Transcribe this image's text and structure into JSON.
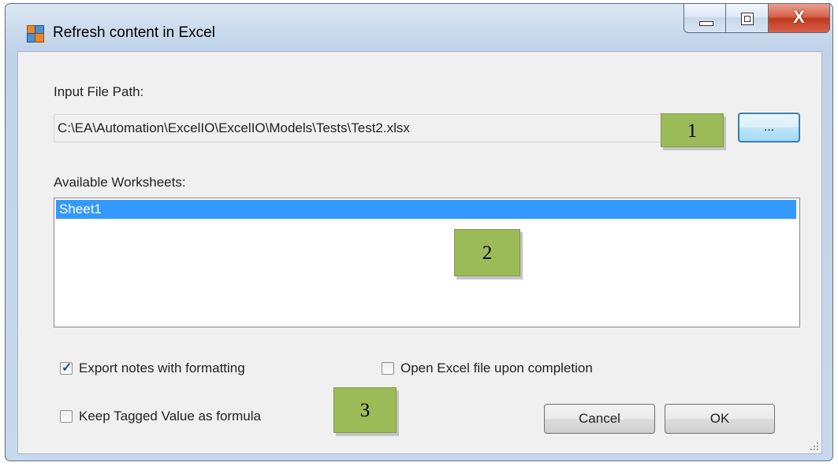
{
  "window": {
    "title": "Refresh content in Excel",
    "close_glyph": "X",
    "controls": [
      "minimize-icon",
      "maximize-icon",
      "close-icon"
    ]
  },
  "input_file": {
    "label": "Input File Path:",
    "value": "C:\\EA\\Automation\\ExcelIO\\ExcelIO\\Models\\Tests\\Test2.xlsx",
    "browse_label": "..."
  },
  "worksheets": {
    "label": "Available Worksheets:",
    "items": [
      {
        "label": "Sheet1",
        "selected": true
      }
    ]
  },
  "options": {
    "export_notes": {
      "label": "Export notes with formatting",
      "checked": true
    },
    "open_excel": {
      "label": "Open Excel file upon completion",
      "checked": false
    },
    "keep_tagged": {
      "label": "Keep Tagged Value as formula",
      "checked": false
    }
  },
  "buttons": {
    "cancel": "Cancel",
    "ok": "OK"
  },
  "callouts": [
    "1",
    "2",
    "3"
  ],
  "colors": {
    "selection": "#3399ff",
    "callout": "#9bbb59",
    "close_button": "#c7432a"
  }
}
